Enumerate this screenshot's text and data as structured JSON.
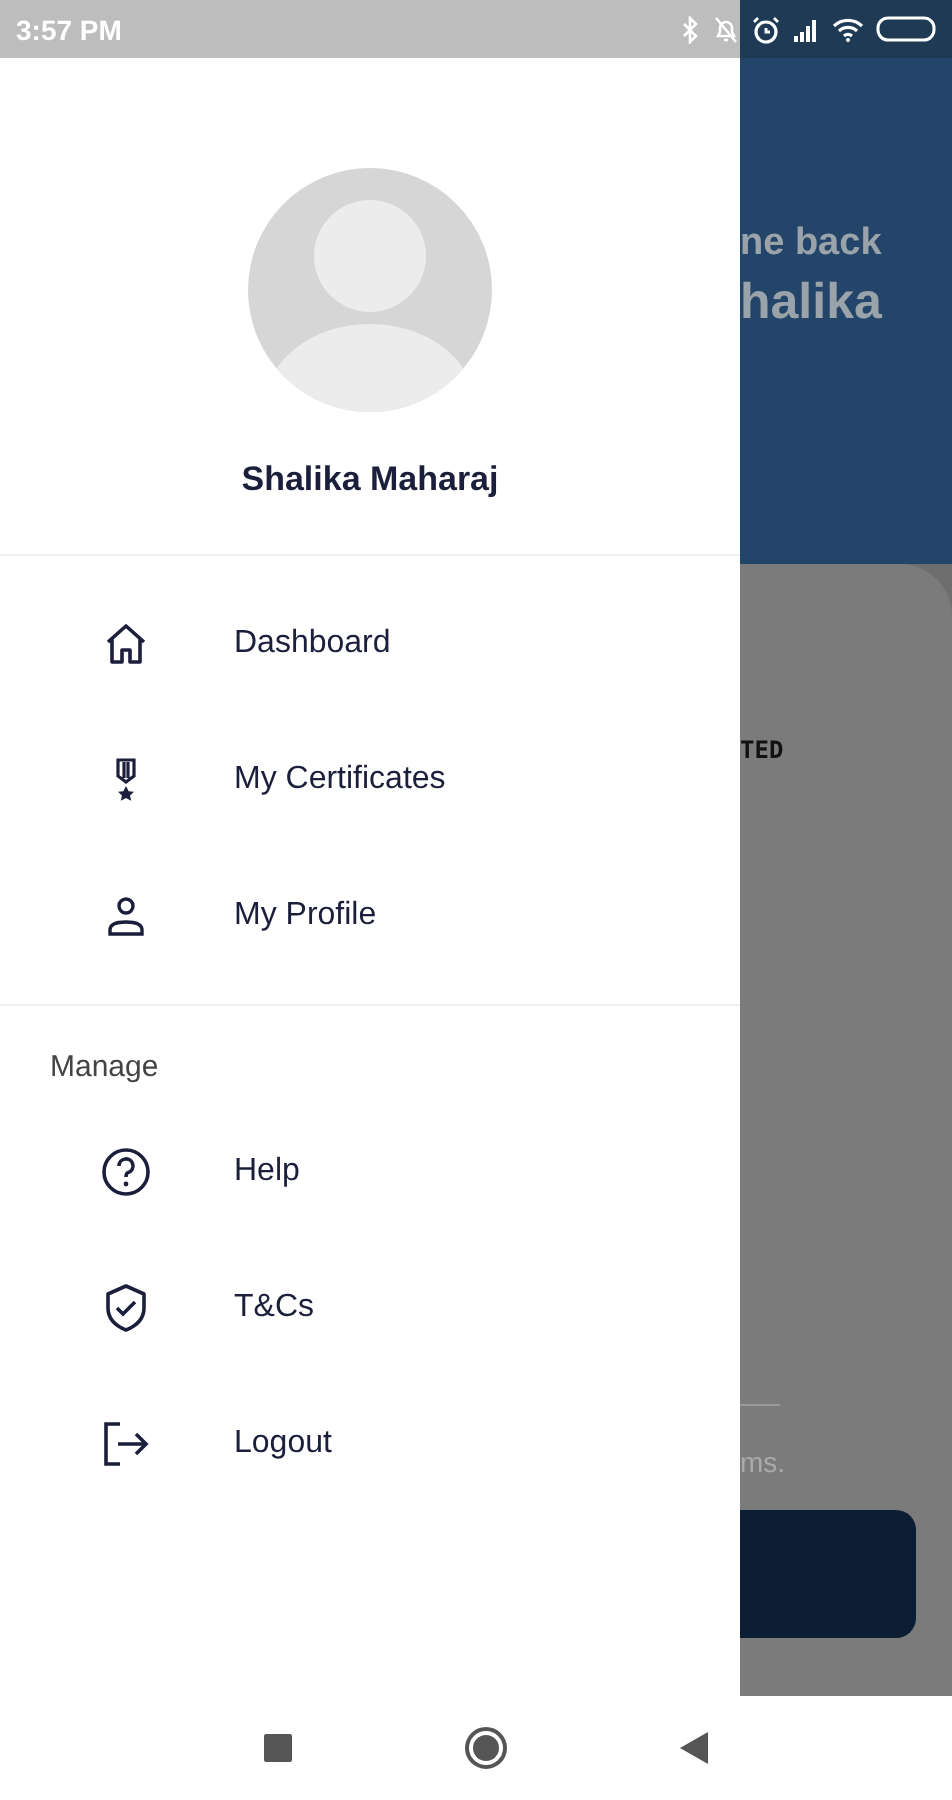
{
  "status_bar": {
    "time": "3:57 PM"
  },
  "drawer": {
    "profile": {
      "name": "Shalika Maharaj"
    },
    "sections": [
      {
        "items": [
          {
            "label": "Dashboard",
            "selected": false
          },
          {
            "label": "My Certificates",
            "selected": false
          },
          {
            "label": "My Profile",
            "selected": false
          }
        ]
      },
      {
        "title": "Manage",
        "items": [
          {
            "label": "Help",
            "selected": false
          },
          {
            "label": "T&Cs",
            "selected": false
          },
          {
            "label": "Logout",
            "selected": false
          }
        ]
      }
    ]
  },
  "background": {
    "greeting": "ne back",
    "name": "halika",
    "card_heading": "TED",
    "card_text": "ms."
  }
}
